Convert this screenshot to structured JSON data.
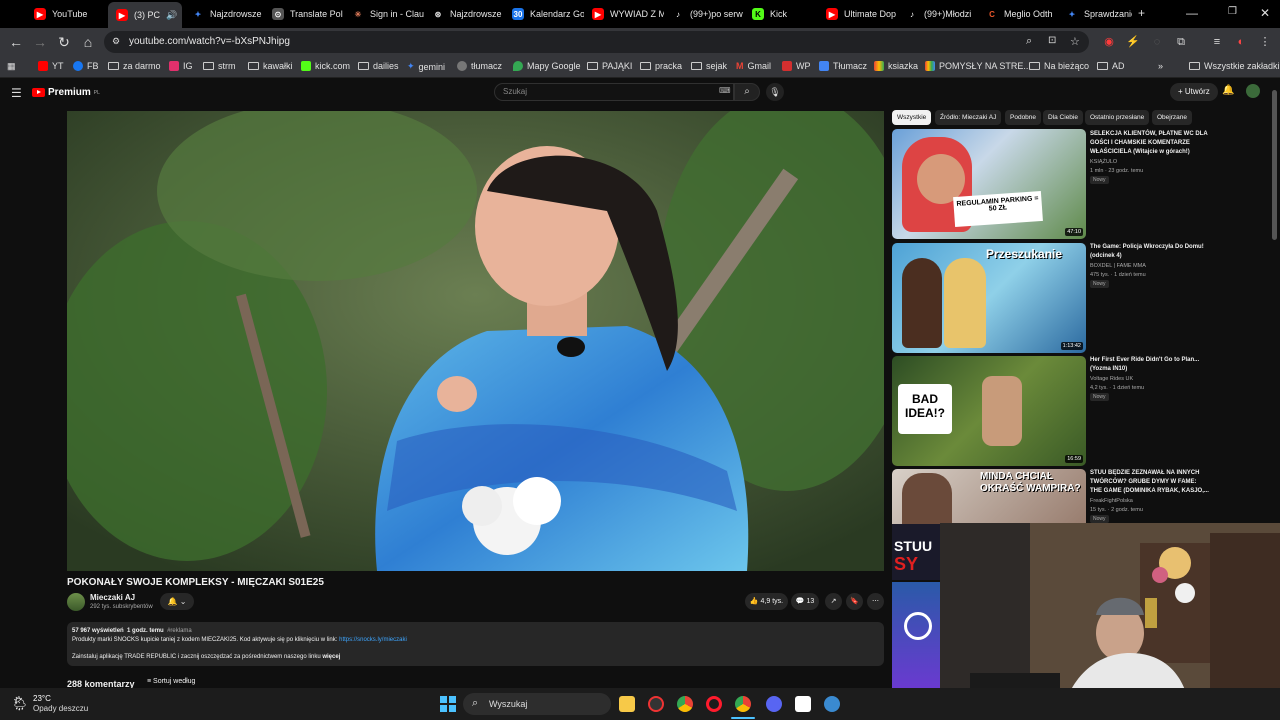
{
  "browser": {
    "tabs": [
      {
        "label": "YouTube",
        "color": "#ff0000"
      },
      {
        "label": "(3) PC",
        "color": "#ff0000"
      },
      {
        "label": "Najzdrowsze",
        "color": "#4285f4"
      },
      {
        "label": "Translate Pol",
        "color": "#555555"
      },
      {
        "label": "Sign in - Clau",
        "color": "#d97757"
      },
      {
        "label": "Najzdrowsze",
        "color": "#888888"
      },
      {
        "label": "Kalendarz Go",
        "color": "#1a73e8"
      },
      {
        "label": "WYWIAD Z M",
        "color": "#ff0000"
      },
      {
        "label": "(99+)po serw",
        "color": "#222222"
      },
      {
        "label": "Kick",
        "color": "#53fc18"
      },
      {
        "label": "Ultimate Dop",
        "color": "#ff0000"
      },
      {
        "label": "(99+)Młodzi",
        "color": "#222222"
      },
      {
        "label": "Meglio Odth",
        "color": "#e8562a"
      },
      {
        "label": "Sprawdzanie",
        "color": "#4285f4"
      }
    ],
    "url": "youtube.com/watch?v=-bXsPNJhipg",
    "bookmarks": [
      "YT",
      "FB",
      "za darmo",
      "IG",
      "strm",
      "kawałki",
      "kick.com",
      "dailies",
      "gemini",
      "tłumacz",
      "Mapy Google",
      "PAJĄKI",
      "pracka",
      "sejak",
      "Gmail",
      "WP",
      "Tłumacz",
      "ksiazka",
      "POMYSŁY NA STRE...",
      "Na bieżąco",
      "AD"
    ],
    "all_bookmarks": "Wszystkie zakładki"
  },
  "youtube": {
    "logo": "Premium",
    "logo_sup": "PL",
    "search_placeholder": "Szukaj",
    "create_label": "Utwórz",
    "video": {
      "title": "POKONAŁY SWOJE KOMPLEKSY - MIĘCZAKI S01E25",
      "channel": "Mieczaki AJ",
      "subscribers": "292 tys. subskrybentów",
      "likes": "4,9 tys.",
      "comments_button": "13",
      "description": {
        "views": "57 967 wyświetleń",
        "time": "1 godz. temu",
        "tag": "#reklama",
        "line1": "Produkty marki SNOCKS kupicie taniej z kodem MIECZAKI25. Kod aktywuje się po kliknięciu w link:",
        "link": "https://snocks.ly/mieczaki",
        "line2": "Zainstaluj aplikację TRADE REPUBLIC i zacznij oszczędzać za pośrednictwem naszego linku",
        "more": "więcej"
      },
      "comments_count": "288 komentarzy",
      "sort_label": "Sortuj według"
    },
    "chips": [
      "Wszystkie",
      "Źródło: Mieczaki AJ",
      "Podobne",
      "Dla Ciebie",
      "Ostatnio przesłane",
      "Obejrzane"
    ],
    "recommendations": [
      {
        "title": "SELEKCJA KLIENTÓW, PŁATNE WC DLA GOŚCI I CHAMSKIE KOMENTARZE WŁAŚCICIELA (Witajcie w górach!)",
        "channel": "KSIĄŻULO",
        "meta": "1 mln · 23 godz. temu",
        "badge": "Nowy",
        "duration": "47:10",
        "thumb_text": "REGULAMIN PARKING = 50 ZŁ"
      },
      {
        "title": "The Game: Policja Wkroczyła Do Domu! (odcinek 4)",
        "channel": "BOXDEL | FAME MMA",
        "meta": "475 tys. · 1 dzień temu",
        "badge": "Nowy",
        "duration": "1:13:42",
        "thumb_text": "Przeszukanie"
      },
      {
        "title": "Her First Ever Ride Didn't Go to Plan... (Yozma IN10)",
        "channel": "Voltage Rides UK",
        "meta": "4,2 tys. · 1 dzień temu",
        "badge": "Nowy",
        "duration": "16:59",
        "thumb_text": "BAD IDEA!?"
      },
      {
        "title": "STUU BĘDZIE ZEZNAWAŁ NA INNYCH TWÓRCÓW? GRUBE DYMY W FAME: THE GAME (DOMINIKA RYBAK, KASJO,...",
        "channel": "FreakFightPolska",
        "meta": "15 tys. · 2 godz. temu",
        "badge": "Nowy",
        "duration": "",
        "thumb_text": "MINDA CHCIAŁ OKRAŚĆ WAMPIRA?"
      }
    ]
  },
  "taskbar": {
    "temperature": "23°C",
    "weather": "Opady deszczu",
    "search_label": "Wyszukaj"
  }
}
